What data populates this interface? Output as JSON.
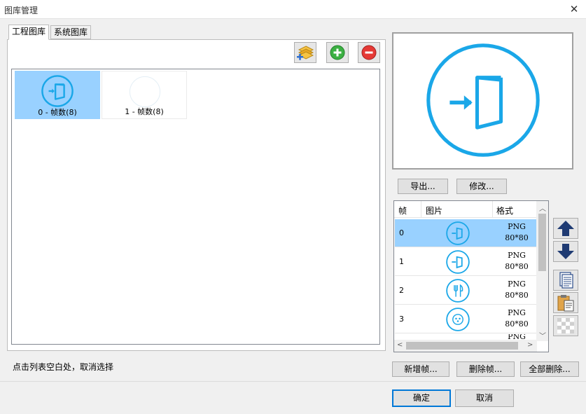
{
  "window": {
    "title": "图库管理",
    "close_glyph": "✕"
  },
  "tabs": [
    {
      "label": "工程图库",
      "active": true
    },
    {
      "label": "系统图库",
      "active": false
    }
  ],
  "toolbar": {
    "import_icon": "layers-add-icon",
    "add_icon": "green-plus-icon",
    "remove_icon": "red-minus-icon"
  },
  "library": {
    "items": [
      {
        "label": "0 - 帧数(8)",
        "selected": true,
        "icon": "door-enter-icon"
      },
      {
        "label": "1 - 帧数(8)",
        "selected": false,
        "icon": "faint-circle-icon"
      }
    ]
  },
  "preview": {
    "icon": "door-enter-icon",
    "accent": "#1aa7e8"
  },
  "buttons": {
    "export": "导出...",
    "modify": "修改...",
    "new_frame": "新增帧...",
    "delete_frame": "删除帧...",
    "delete_all": "全部删除...",
    "ok": "确定",
    "cancel": "取消"
  },
  "frames_table": {
    "headers": [
      "帧",
      "图片",
      "格式"
    ],
    "rows": [
      {
        "index": "0",
        "icon": "door-enter-icon",
        "format": "PNG",
        "size": "80*80",
        "selected": true
      },
      {
        "index": "1",
        "icon": "door-enter-icon",
        "format": "PNG",
        "size": "80*80",
        "selected": false
      },
      {
        "index": "2",
        "icon": "fork-knife-icon",
        "format": "PNG",
        "size": "80*80",
        "selected": false
      },
      {
        "index": "3",
        "icon": "dots-circle-icon",
        "format": "PNG",
        "size": "80*80",
        "selected": false
      }
    ],
    "partial_row_format": "PNG"
  },
  "side_tools": [
    "arrow-up-icon",
    "arrow-down-icon",
    "copy-icon",
    "paste-icon",
    "transparent-icon"
  ],
  "hint": "点击列表空白处，取消选择"
}
